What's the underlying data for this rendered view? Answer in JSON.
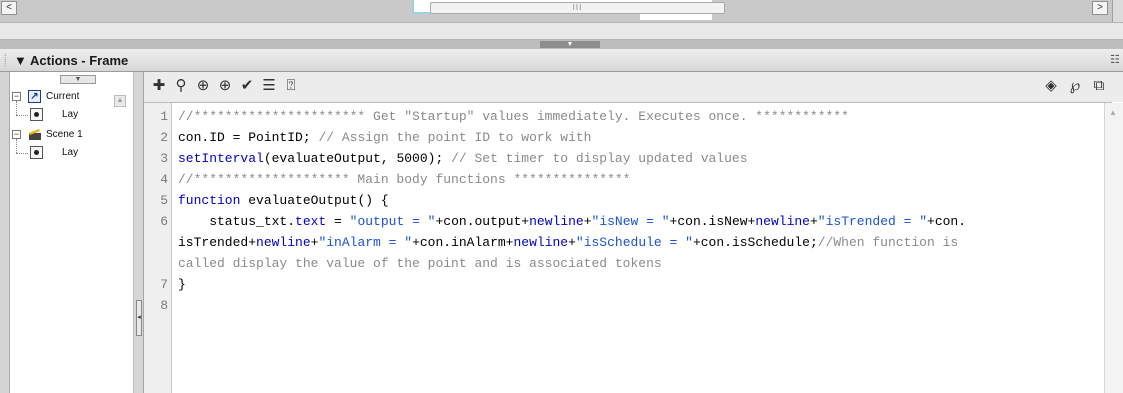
{
  "panel": {
    "title": "Actions - Frame",
    "collapse_glyph": "▼",
    "menu_icon": "options-menu-icon"
  },
  "hscroll": {
    "left_arrow": "<",
    "right_arrow": ">",
    "thumb_grip": "III"
  },
  "navigator": {
    "items": [
      {
        "label": "Current",
        "icon": "current-selection-icon"
      },
      {
        "label": "Lay",
        "icon": "layer-icon"
      },
      {
        "label": "Scene 1",
        "icon": "scene-icon"
      },
      {
        "label": "Lay",
        "icon": "layer-icon"
      }
    ],
    "expand_glyph": "−"
  },
  "toolbar": {
    "left_icons": [
      "add-statement-icon",
      "find-icon",
      "insert-target-path-icon",
      "crosshair-icon",
      "check-syntax-icon",
      "auto-format-icon",
      "code-hint-icon"
    ],
    "right_icons": [
      "debug-options-icon",
      "script-assist-icon",
      "help-icon"
    ]
  },
  "editor": {
    "line_numbers": [
      "1",
      "2",
      "3",
      "4",
      "5",
      "6",
      "",
      "",
      "7",
      "8"
    ],
    "lines": [
      {
        "segments": [
          {
            "t": "//********************** Get \"Startup\" values immediately. Executes once. ************",
            "c": "comment"
          }
        ]
      },
      {
        "segments": [
          {
            "t": "con.ID = PointID; ",
            "c": "plain"
          },
          {
            "t": "// Assign the point ID to work with",
            "c": "comment"
          }
        ]
      },
      {
        "segments": [
          {
            "t": "setInterval",
            "c": "kw"
          },
          {
            "t": "(evaluateOutput, 5000); ",
            "c": "plain"
          },
          {
            "t": "// Set timer to display updated values",
            "c": "comment"
          }
        ]
      },
      {
        "segments": [
          {
            "t": "//******************** Main body functions ***************",
            "c": "comment"
          }
        ]
      },
      {
        "segments": [
          {
            "t": "function",
            "c": "kw"
          },
          {
            "t": " evaluateOutput() {",
            "c": "plain"
          }
        ]
      },
      {
        "segments": [
          {
            "t": "    status_txt.",
            "c": "plain"
          },
          {
            "t": "text",
            "c": "kw"
          },
          {
            "t": " = ",
            "c": "plain"
          },
          {
            "t": "\"output = \"",
            "c": "str"
          },
          {
            "t": "+con.output+",
            "c": "plain"
          },
          {
            "t": "newline",
            "c": "kw"
          },
          {
            "t": "+",
            "c": "plain"
          },
          {
            "t": "\"isNew = \"",
            "c": "str"
          },
          {
            "t": "+con.isNew+",
            "c": "plain"
          },
          {
            "t": "newline",
            "c": "kw"
          },
          {
            "t": "+",
            "c": "plain"
          },
          {
            "t": "\"isTrended = \"",
            "c": "str"
          },
          {
            "t": "+con.",
            "c": "plain"
          }
        ]
      },
      {
        "segments": [
          {
            "t": "isTrended+",
            "c": "plain"
          },
          {
            "t": "newline",
            "c": "kw"
          },
          {
            "t": "+",
            "c": "plain"
          },
          {
            "t": "\"inAlarm = \"",
            "c": "str"
          },
          {
            "t": "+con.inAlarm+",
            "c": "plain"
          },
          {
            "t": "newline",
            "c": "kw"
          },
          {
            "t": "+",
            "c": "plain"
          },
          {
            "t": "\"isSchedule = \"",
            "c": "str"
          },
          {
            "t": "+con.isSchedule;",
            "c": "plain"
          },
          {
            "t": "//When function is",
            "c": "comment"
          }
        ]
      },
      {
        "segments": [
          {
            "t": "called display the value of the point and is associated tokens",
            "c": "comment"
          }
        ]
      },
      {
        "segments": [
          {
            "t": "}",
            "c": "plain"
          }
        ]
      },
      {
        "segments": []
      }
    ]
  },
  "colors": {
    "keyword": "#0000c8",
    "string": "#1a52d6",
    "comment": "#8a8a8a",
    "stage_frame": "#9ecfe8"
  }
}
